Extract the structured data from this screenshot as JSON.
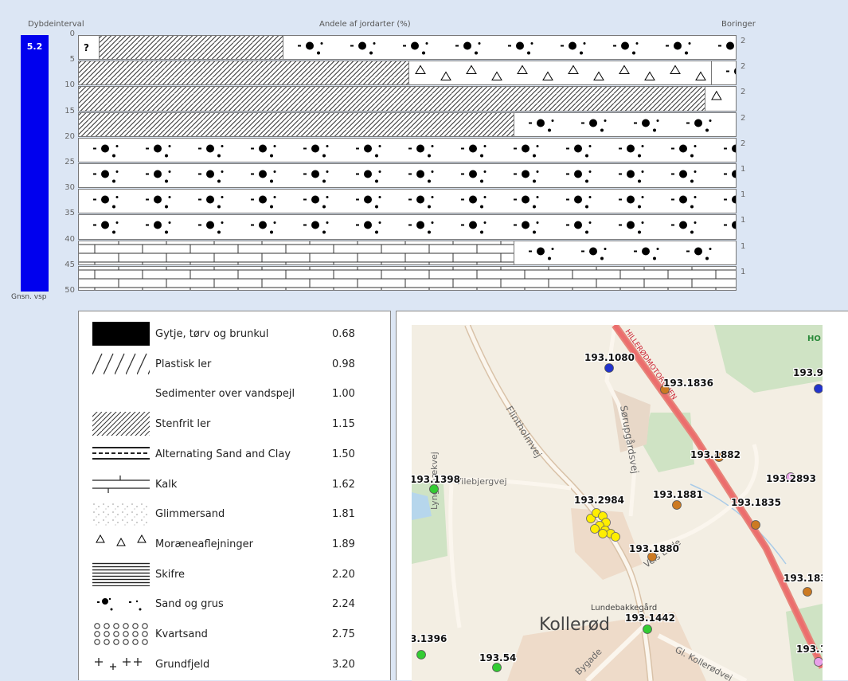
{
  "header": {
    "depth_interval": "Dybdeinterval",
    "shares_title": "Andele af jordarter (%)",
    "borings": "Boringer"
  },
  "vsp": {
    "value": "5.2",
    "label": "Gnsn. vsp"
  },
  "depth_ticks": [
    "0",
    "5",
    "10",
    "15",
    "20",
    "25",
    "30",
    "35",
    "40",
    "45",
    "50"
  ],
  "chart_data": {
    "type": "bar",
    "title": "Andele af jordarter (%)",
    "xlabel": "Andele af jordarter (%)",
    "ylabel": "Dybdeinterval",
    "ylim": [
      0,
      50
    ],
    "xlim": [
      0,
      100
    ],
    "intervals": [
      {
        "depth": "0-5",
        "borings": "2",
        "segments": [
          {
            "soil": "unknown",
            "label": "?",
            "pct": 3
          },
          {
            "soil": "stenfrit_ler",
            "pct": 28
          },
          {
            "soil": "sand_og_grus",
            "pct": 69
          }
        ]
      },
      {
        "depth": "5-10",
        "borings": "2",
        "segments": [
          {
            "soil": "stenfrit_ler",
            "pct": 50
          },
          {
            "soil": "moraeneaflejninger",
            "pct": 46
          },
          {
            "soil": "sand_og_grus",
            "pct": 4
          }
        ]
      },
      {
        "depth": "10-15",
        "borings": "2",
        "segments": [
          {
            "soil": "stenfrit_ler",
            "pct": 95
          },
          {
            "soil": "moraeneaflejninger",
            "pct": 5
          }
        ]
      },
      {
        "depth": "15-20",
        "borings": "2",
        "segments": [
          {
            "soil": "stenfrit_ler",
            "pct": 66
          },
          {
            "soil": "sand_og_grus",
            "pct": 34
          }
        ]
      },
      {
        "depth": "20-25",
        "borings": "2",
        "segments": [
          {
            "soil": "sand_og_grus",
            "pct": 100
          }
        ]
      },
      {
        "depth": "25-30",
        "borings": "1",
        "segments": [
          {
            "soil": "sand_og_grus",
            "pct": 100
          }
        ]
      },
      {
        "depth": "30-35",
        "borings": "1",
        "segments": [
          {
            "soil": "sand_og_grus",
            "pct": 100
          }
        ]
      },
      {
        "depth": "35-40",
        "borings": "1",
        "segments": [
          {
            "soil": "sand_og_grus",
            "pct": 100
          }
        ]
      },
      {
        "depth": "40-45",
        "borings": "1",
        "segments": [
          {
            "soil": "kalk",
            "pct": 66
          },
          {
            "soil": "sand_og_grus",
            "pct": 34
          }
        ]
      },
      {
        "depth": "45-50",
        "borings": "1",
        "segments": [
          {
            "soil": "kalk",
            "pct": 100
          }
        ]
      }
    ]
  },
  "legend": [
    {
      "key": "gytje",
      "name": "Gytje, tørv og brunkul",
      "value": "0.68"
    },
    {
      "key": "plastisk_ler",
      "name": "Plastisk ler",
      "value": "0.98"
    },
    {
      "key": "sedimenter",
      "name": "Sedimenter over vandspejl",
      "value": "1.00"
    },
    {
      "key": "stenfrit_ler",
      "name": "Stenfrit ler",
      "value": "1.15"
    },
    {
      "key": "alternating",
      "name": "Alternating Sand and Clay",
      "value": "1.50"
    },
    {
      "key": "kalk",
      "name": "Kalk",
      "value": "1.62"
    },
    {
      "key": "glimmersand",
      "name": "Glimmersand",
      "value": "1.81"
    },
    {
      "key": "moraeneaflejninger",
      "name": "Moræneaflejninger",
      "value": "1.89"
    },
    {
      "key": "skifre",
      "name": "Skifre",
      "value": "2.20"
    },
    {
      "key": "sand_og_grus",
      "name": "Sand og grus",
      "value": "2.24"
    },
    {
      "key": "kvartsand",
      "name": "Kvartsand",
      "value": "2.75"
    },
    {
      "key": "grundfjeld",
      "name": "Grundfjeld",
      "value": "3.20"
    }
  ],
  "map": {
    "places": [
      {
        "text": "Kollerød"
      },
      {
        "text": "Lundebakkegård"
      },
      {
        "text": "HO"
      }
    ],
    "roads": [
      "Flintholmvej",
      "Sørupgårdsvej",
      "Lyngebækvej",
      "Vilebjergvej",
      "Veis Ende",
      "HILLERØDMOTORVEJEN",
      "Bygade",
      "Gl. Kollerødvej"
    ],
    "wells": [
      {
        "id": "193.1080",
        "color": "#2233cc"
      },
      {
        "id": "193.1836",
        "color": "#cc7a22"
      },
      {
        "id": "193.9",
        "color": "#2233cc"
      },
      {
        "id": "193.1882",
        "color": "#cc7a22"
      },
      {
        "id": "193.2893",
        "color": "#e8a0e8"
      },
      {
        "id": "193.1398",
        "color": "#33cc33"
      },
      {
        "id": "193.2984",
        "color": "#ffee00"
      },
      {
        "id": "193.1881",
        "color": "#cc7a22"
      },
      {
        "id": "193.1835",
        "color": "#cc7a22"
      },
      {
        "id": "193.1880",
        "color": "#cc7a22"
      },
      {
        "id": "193.183",
        "color": "#cc7a22"
      },
      {
        "id": "193.1442",
        "color": "#33cc33"
      },
      {
        "id": "3.1396",
        "color": "#33cc33"
      },
      {
        "id": "193.54",
        "color": "#33cc33"
      },
      {
        "id": "193.1",
        "color": "#e8a0e8"
      }
    ]
  }
}
